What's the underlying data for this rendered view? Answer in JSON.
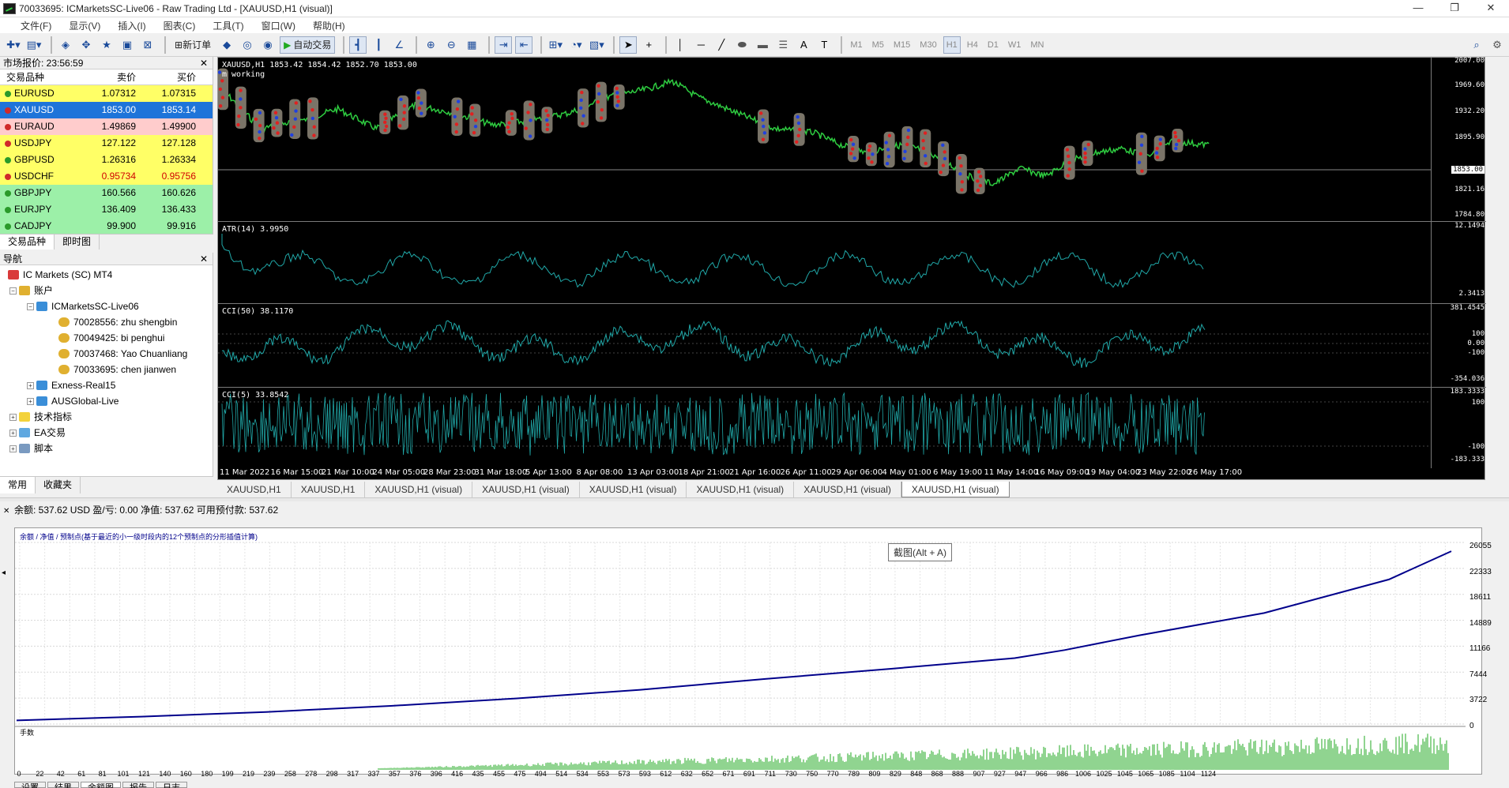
{
  "window": {
    "title": "70033695: ICMarketsSC-Live06 - Raw Trading Ltd - [XAUUSD,H1 (visual)]",
    "controls": [
      "—",
      "❐",
      "✕"
    ]
  },
  "menu": [
    "文件(F)",
    "显示(V)",
    "插入(I)",
    "图表(C)",
    "工具(T)",
    "窗口(W)",
    "帮助(H)"
  ],
  "toolbar": {
    "new_order": "新订单",
    "auto_trading": "自动交易",
    "timeframes": [
      "M1",
      "M5",
      "M15",
      "M30",
      "H1",
      "H4",
      "D1",
      "W1",
      "MN"
    ],
    "active_timeframe": "H1"
  },
  "market_watch": {
    "title": "市场报价: 23:56:59",
    "columns": [
      "交易品种",
      "卖价",
      "买价"
    ],
    "rows": [
      {
        "symbol": "EURUSD",
        "bid": "1.07312",
        "ask": "1.07315",
        "style": "yellow",
        "dir": "up"
      },
      {
        "symbol": "XAUUSD",
        "bid": "1853.00",
        "ask": "1853.14",
        "style": "selected",
        "dir": "down"
      },
      {
        "symbol": "EURAUD",
        "bid": "1.49869",
        "ask": "1.49900",
        "style": "pink",
        "dir": "down"
      },
      {
        "symbol": "USDJPY",
        "bid": "127.122",
        "ask": "127.128",
        "style": "yellow",
        "dir": "down"
      },
      {
        "symbol": "GBPUSD",
        "bid": "1.26316",
        "ask": "1.26334",
        "style": "yellow",
        "dir": "up"
      },
      {
        "symbol": "USDCHF",
        "bid": "0.95734",
        "ask": "0.95756",
        "style": "yellow-red",
        "dir": "down"
      },
      {
        "symbol": "GBPJPY",
        "bid": "160.566",
        "ask": "160.626",
        "style": "green",
        "dir": "up"
      },
      {
        "symbol": "EURJPY",
        "bid": "136.409",
        "ask": "136.433",
        "style": "green",
        "dir": "up"
      },
      {
        "symbol": "CADJPY",
        "bid": "99.900",
        "ask": "99.916",
        "style": "green",
        "dir": "up"
      }
    ],
    "tabs": [
      "交易品种",
      "即时图"
    ]
  },
  "navigator": {
    "title": "导航",
    "root": "IC Markets (SC) MT4",
    "accounts_label": "账户",
    "server": "ICMarketsSC-Live06",
    "users": [
      "70028556: zhu shengbin",
      "70049425: bi penghui",
      "70037468: Yao Chuanliang",
      "70033695: chen jianwen"
    ],
    "other_servers": [
      "Exness-Real15",
      "AUSGlobal-Live"
    ],
    "folders": [
      "技术指标",
      "EA交易",
      "脚本"
    ],
    "tabs": [
      "常用",
      "收藏夹"
    ]
  },
  "chart": {
    "price_label": "XAUUSD,H1  1853.42 1854.42 1852.70 1853.00",
    "ea_status": "m working",
    "price_scale": [
      "2007.00",
      "1969.60",
      "1932.20",
      "1895.90",
      "1853.00",
      "1821.16",
      "1784.80"
    ],
    "current_price": "1853.00",
    "atr_label": "ATR(14) 3.9950",
    "atr_scale": [
      "12.1494",
      "2.3413"
    ],
    "cci50_label": "CCI(50) 38.1170",
    "cci50_scale": [
      "381.4545",
      "100",
      "0.00",
      "-100",
      "-354.036"
    ],
    "cci5_label": "CCI(5) 33.8542",
    "cci5_scale": [
      "183.3333",
      "100",
      "-100",
      "-183.333"
    ],
    "time_axis": [
      "11 Mar 2022",
      "16 Mar 15:00",
      "21 Mar 10:00",
      "24 Mar 05:00",
      "28 Mar 23:00",
      "31 Mar 18:00",
      "5 Apr 13:00",
      "8 Apr 08:00",
      "13 Apr 03:00",
      "18 Apr 21:00",
      "21 Apr 16:00",
      "26 Apr 11:00",
      "29 Apr 06:00",
      "4 May 01:00",
      "6 May 19:00",
      "11 May 14:00",
      "16 May 09:00",
      "19 May 04:00",
      "23 May 22:00",
      "26 May 17:00"
    ],
    "colors": {
      "price": "#2ecc40",
      "indicator": "#20a8a8",
      "bg": "#000000"
    }
  },
  "chart_tabs": [
    "XAUUSD,H1",
    "XAUUSD,H1",
    "XAUUSD,H1 (visual)",
    "XAUUSD,H1 (visual)",
    "XAUUSD,H1 (visual)",
    "XAUUSD,H1 (visual)",
    "XAUUSD,H1 (visual)",
    "XAUUSD,H1 (visual)"
  ],
  "active_chart_tab": 7,
  "account_bar": "余额: 537.62 USD  盈/亏: 0.00  净值: 537.62  可用预付款: 537.62",
  "tester": {
    "legend": "余额 / 净值 / 预制点(基于最近的小一级时段内的12个预制点的分形插值计算)",
    "tooltip": "截图(Alt + A)",
    "lots_label": "手数",
    "y_ticks": [
      "26055",
      "22333",
      "18611",
      "14889",
      "11166",
      "7444",
      "3722",
      "0"
    ],
    "x_ticks": [
      "0",
      "22",
      "42",
      "61",
      "81",
      "101",
      "121",
      "140",
      "160",
      "180",
      "199",
      "219",
      "239",
      "258",
      "278",
      "298",
      "317",
      "337",
      "357",
      "376",
      "396",
      "416",
      "435",
      "455",
      "475",
      "494",
      "514",
      "534",
      "553",
      "573",
      "593",
      "612",
      "632",
      "652",
      "671",
      "691",
      "711",
      "730",
      "750",
      "770",
      "789",
      "809",
      "829",
      "848",
      "868",
      "888",
      "907",
      "927",
      "947",
      "966",
      "986",
      "1006",
      "1025",
      "1045",
      "1065",
      "1085",
      "1104",
      "1124"
    ],
    "tabs": [
      "设置",
      "结果",
      "余额图",
      "报告",
      "日志"
    ],
    "active_tab": 2,
    "colors": {
      "balance": "#00008b",
      "lots": "#22aa22"
    }
  },
  "chart_data": {
    "type": "line",
    "title": "",
    "xlabel": "",
    "ylabel": "",
    "ylim": [
      0,
      27000
    ],
    "x": [
      0,
      100,
      200,
      300,
      400,
      500,
      600,
      700,
      800,
      840,
      900,
      1000,
      1100,
      1150
    ],
    "series": [
      {
        "name": "余额",
        "values": [
          537,
          1100,
          1800,
          2700,
          3800,
          5100,
          6700,
          8200,
          9800,
          11000,
          13200,
          16500,
          21500,
          25700
        ]
      }
    ]
  }
}
